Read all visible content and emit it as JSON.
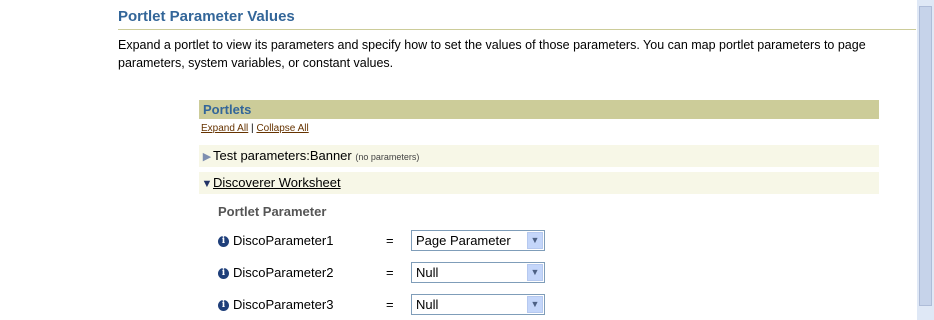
{
  "page": {
    "title": "Portlet Parameter Values",
    "description": "Expand a portlet to view its parameters and specify how to set the values of those parameters. You can map portlet parameters to page parameters, system variables, or constant values."
  },
  "portlets": {
    "header": "Portlets",
    "expand_all": "Expand All",
    "separator": "|",
    "collapse_all": "Collapse All",
    "items": [
      {
        "label": "Test parameters:Banner",
        "note": "(no parameters)"
      },
      {
        "label": "Discoverer Worksheet"
      }
    ],
    "parameter_header": "Portlet Parameter",
    "parameters": [
      {
        "name": "DiscoParameter1",
        "eq": "=",
        "value": "Page Parameter"
      },
      {
        "name": "DiscoParameter2",
        "eq": "=",
        "value": "Null"
      },
      {
        "name": "DiscoParameter3",
        "eq": "=",
        "value": "Null"
      }
    ]
  },
  "icons": {
    "expand": "triangle-right-icon",
    "collapse": "triangle-down-icon",
    "info": "info-icon",
    "dropdown": "chevron-down-icon"
  },
  "colors": {
    "title": "#336699",
    "header_band": "#cccc99",
    "row_band": "#f7f7e7"
  }
}
